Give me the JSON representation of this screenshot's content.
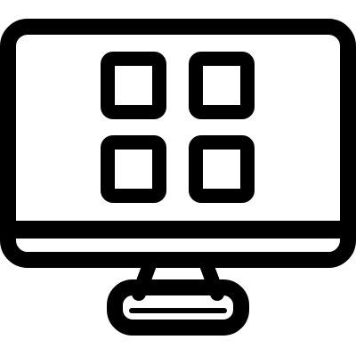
{
  "icon": {
    "name": "desktop-monitor-with-app-grid-icon",
    "stroke_color": "#000000",
    "background_color": "#ffffff",
    "grid": {
      "name": "app-grid-icon",
      "rows": 2,
      "columns": 2
    }
  }
}
